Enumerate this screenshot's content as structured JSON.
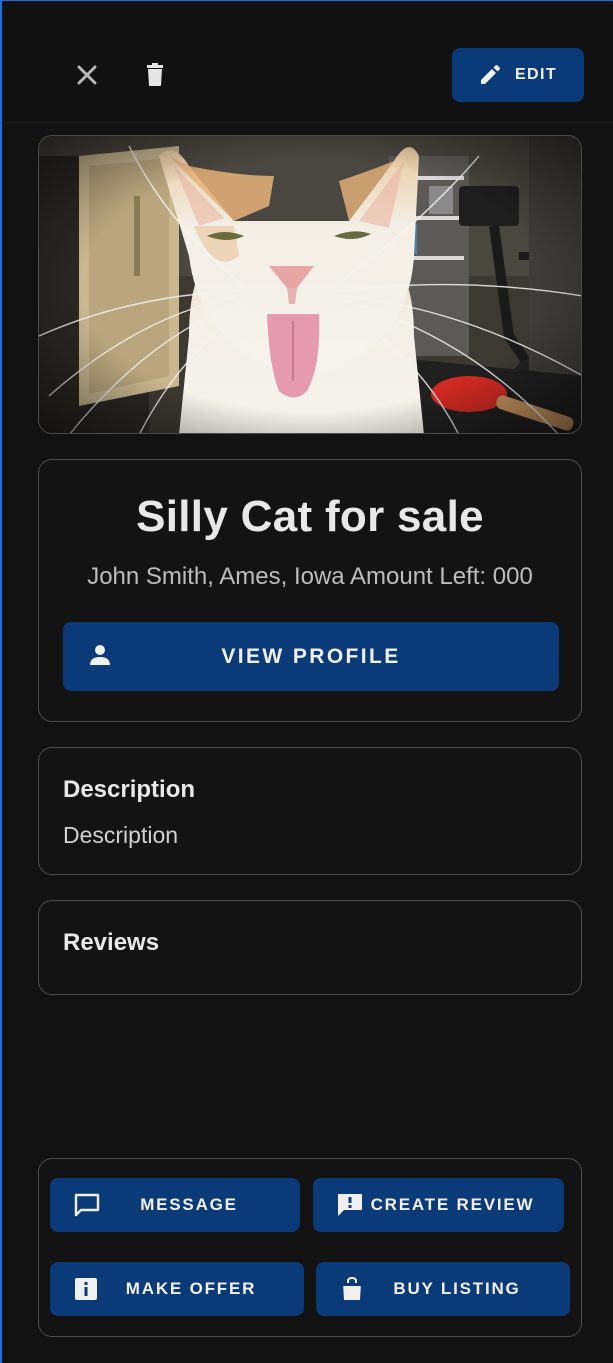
{
  "toolbar": {
    "close_icon": "close-icon",
    "delete_icon": "trash-icon",
    "edit_label": "EDIT",
    "edit_icon": "pencil-icon"
  },
  "listing": {
    "photo_alt": "white and orange cat sticking out its tongue",
    "title": "Silly Cat for sale",
    "subtitle": "John Smith, Ames, Iowa Amount Left: 000",
    "view_profile_label": "VIEW PROFILE",
    "view_profile_icon": "person-icon"
  },
  "description": {
    "heading": "Description",
    "body": "Description"
  },
  "reviews": {
    "heading": "Reviews"
  },
  "actions": {
    "message_label": "MESSAGE",
    "create_review_label": "CREATE REVIEW",
    "make_offer_label": "MAKE OFFER",
    "buy_listing_label": "BUY LISTING"
  },
  "colors": {
    "background": "#121212",
    "button": "#0b3a78",
    "card_border": "#4d4d4d",
    "text": "#e8e8e8"
  }
}
